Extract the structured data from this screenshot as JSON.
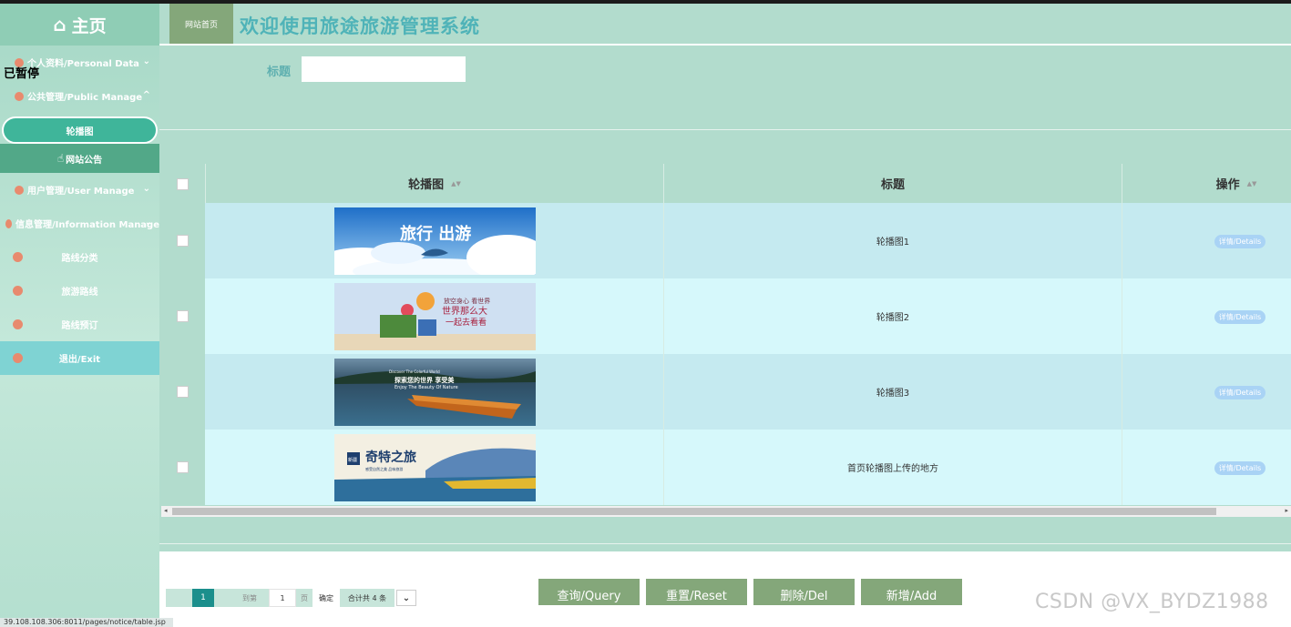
{
  "sidebar": {
    "home_label": "主页",
    "groups": [
      {
        "label": "个人资料/Personal Data"
      },
      {
        "label": "公共管理/Public Manage"
      }
    ],
    "sub_items": [
      {
        "label": "轮播图"
      },
      {
        "label": "网站公告"
      }
    ],
    "groups2": [
      {
        "label": "用户管理/User Manage"
      },
      {
        "label": "信息管理/Information Manage"
      }
    ],
    "info_items": [
      {
        "label": "路线分类"
      },
      {
        "label": "旅游路线"
      },
      {
        "label": "路线预订"
      }
    ],
    "exit_label": "退出/Exit",
    "overlay_text": "已暂停",
    "status_url": "39.108.108.306:8011/pages/notice/table.jsp"
  },
  "header": {
    "home_tab": "网站首页",
    "title": "欢迎使用旅途旅游管理系统"
  },
  "search": {
    "label": "标题",
    "value": ""
  },
  "table": {
    "columns": [
      "轮播图",
      "标题",
      "操作"
    ],
    "rows": [
      {
        "title": "轮播图1",
        "image": "sky-clouds-whale-banner",
        "action": "详情/Details"
      },
      {
        "title": "轮播图2",
        "image": "travel-balloon-banner",
        "action": "详情/Details"
      },
      {
        "title": "轮播图3",
        "image": "lake-boat-banner",
        "action": "详情/Details"
      },
      {
        "title": "首页轮播图上传的地方",
        "image": "mountain-lake-banner",
        "action": "详情/Details"
      }
    ],
    "banner_texts": {
      "r1": "旅行 出游",
      "r2_line1": "放空身心 看世界",
      "r2_line2": "世界那么大",
      "r2_line3": "一起去看看",
      "r3_small": "Discover The Colorful World",
      "r3_main": "探索您的世界 享受美",
      "r3_sub": "Enjoy The Beauty Of Nature",
      "r4_main": "奇特之旅",
      "r4_badge": "新疆",
      "r4_sub": "感受自然之美 品味旅游"
    }
  },
  "pager": {
    "current_page": "1",
    "goto_label": "到第",
    "input_value": "1",
    "page_label": "页",
    "confirm_label": "确定",
    "total_label": "合计共 4 条"
  },
  "buttons": {
    "query": "查询/Query",
    "reset": "重置/Reset",
    "delete": "删除/Del",
    "add": "新增/Add"
  },
  "watermark": "CSDN @VX_BYDZ1988",
  "colors": {
    "primary_bg": "#b2dccd",
    "row_alt_a": "#c5eaf0",
    "row_alt_b": "#d6f8fb",
    "button_green": "#84a77a",
    "title_teal": "#4fb3b8",
    "page_active": "#1b8f8c"
  }
}
